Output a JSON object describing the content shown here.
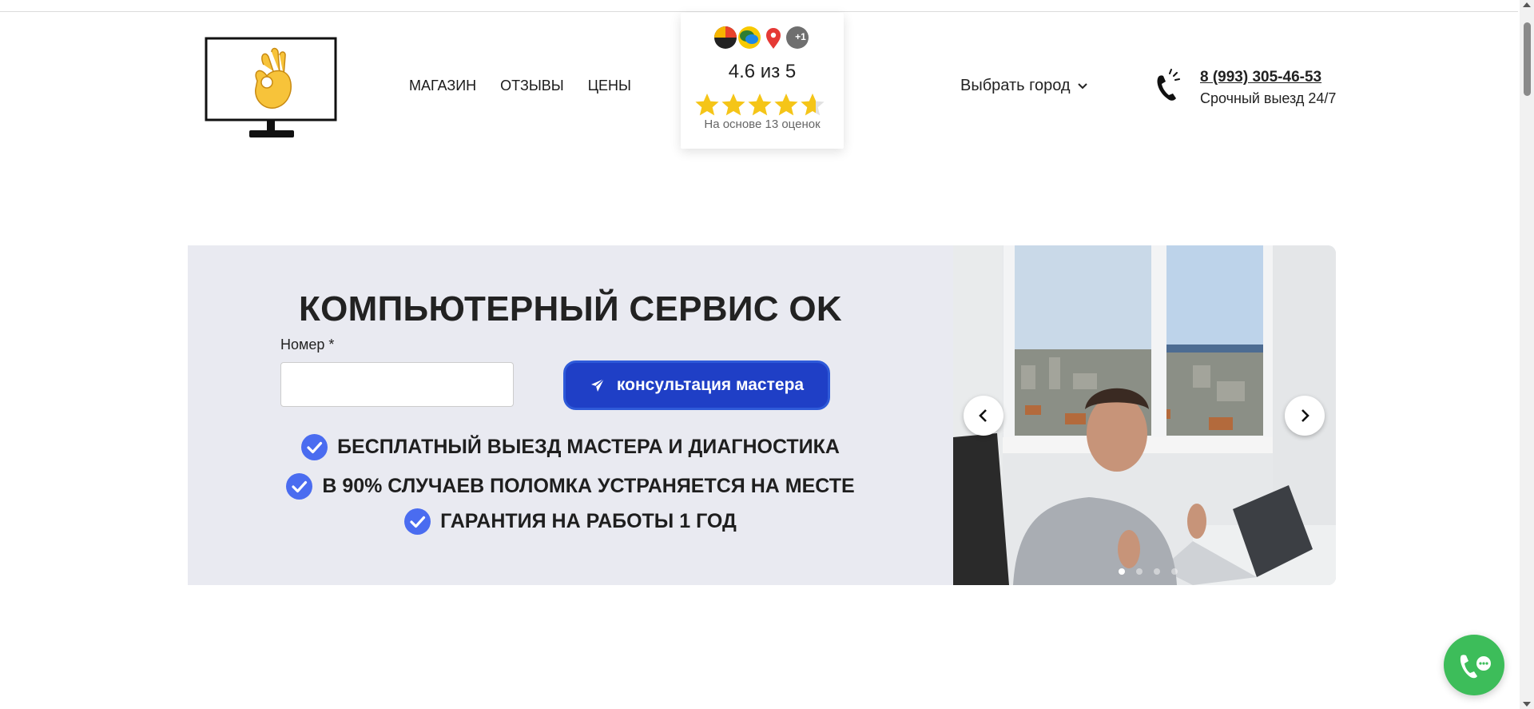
{
  "header": {
    "logo_icon": "ok-hand-monitor-icon",
    "nav": [
      {
        "label": "МАГАЗИН"
      },
      {
        "label": "ОТЗЫВЫ"
      },
      {
        "label": "ЦЕНЫ"
      }
    ],
    "rating": {
      "source_icons": [
        "yandex-icon",
        "chat-bubbles-icon",
        "map-pin-icon"
      ],
      "more_badge": "+1",
      "score": "4.6 из 5",
      "stars_value": 4.6,
      "stars_max": 5,
      "note": "На основе 13 оценок"
    },
    "city_select": {
      "label": "Выбрать город",
      "icon": "chevron-down-icon"
    },
    "contact": {
      "icon": "phone-ringing-icon",
      "phone": "8 (993) 305-46-53",
      "subtitle": "Срочный выезд 24/7"
    }
  },
  "hero": {
    "title": "КОМПЬЮТЕРНЫЙ СЕРВИС OK",
    "form": {
      "label": "Номер *",
      "value": "",
      "placeholder": "",
      "submit_label": "консультация мастера",
      "submit_icon": "paper-plane-icon"
    },
    "features": [
      {
        "icon": "check-circle-icon",
        "text": "БЕСПЛАТНЫЙ ВЫЕЗД МАСТЕРА И ДИАГНОСТИКА"
      },
      {
        "icon": "check-circle-icon",
        "text": "В 90% СЛУЧАЕВ ПОЛОМКА УСТРАНЯЕТСЯ НА МЕСТЕ"
      },
      {
        "icon": "check-circle-icon",
        "text": "ГАРАНТИЯ НА РАБОТЫ 1 ГОД"
      }
    ]
  },
  "slider": {
    "slide_count": 4,
    "active_slide": 1,
    "prev_icon": "chevron-left-icon",
    "next_icon": "chevron-right-icon"
  },
  "floating": {
    "call_button_icon": "phone-chat-icon"
  },
  "colors": {
    "accent_blue": "#1f3fc6",
    "check_blue": "#4a6cf0",
    "hero_bg": "#e9eaf1",
    "star_yellow": "#f5c518",
    "call_green": "#3dbd5a"
  }
}
